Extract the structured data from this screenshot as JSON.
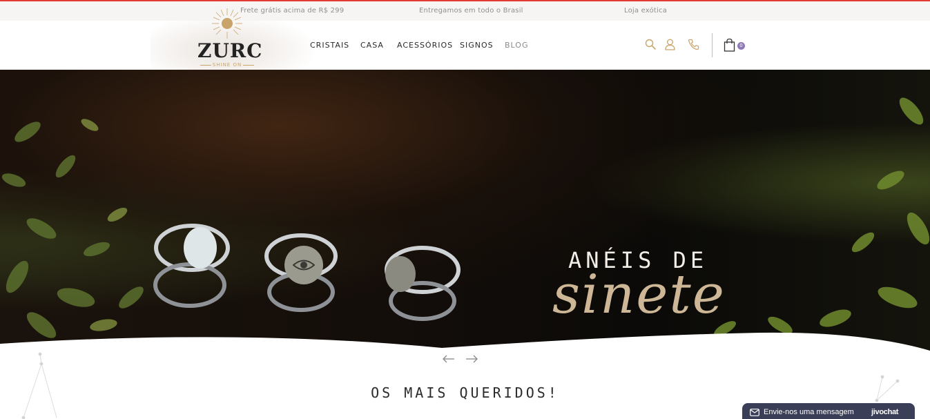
{
  "topbar": {
    "items": [
      "Frete grátis acima de R$ 299",
      "Entregamos em todo o Brasil",
      "Loja exótica"
    ]
  },
  "logo": {
    "name": "ZURC",
    "tagline": "SHINE ON"
  },
  "nav": {
    "items": [
      {
        "label": "CRISTAIS"
      },
      {
        "label": "CASA"
      },
      {
        "label": "ACESSÓRIOS"
      },
      {
        "label": "SIGNOS"
      },
      {
        "label": "BLOG"
      }
    ]
  },
  "header_icons": [
    "search-icon",
    "user-icon",
    "phone-icon",
    "shopping-bag-icon"
  ],
  "cart": {
    "count": "0"
  },
  "hero": {
    "title": "ANÉIS DE",
    "script": "sinete"
  },
  "slider": {
    "prev_icon": "arrow-left-icon",
    "next_icon": "arrow-right-icon"
  },
  "section": {
    "title": "OS MAIS QUERIDOS!"
  },
  "chat": {
    "label": "Envie-nos uma mensagem",
    "brand": "jivochat"
  },
  "colors": {
    "accent": "#c9a46a",
    "badge": "#8e79b8",
    "chat_bg": "#3a3e57",
    "top_border": "#e53935"
  }
}
